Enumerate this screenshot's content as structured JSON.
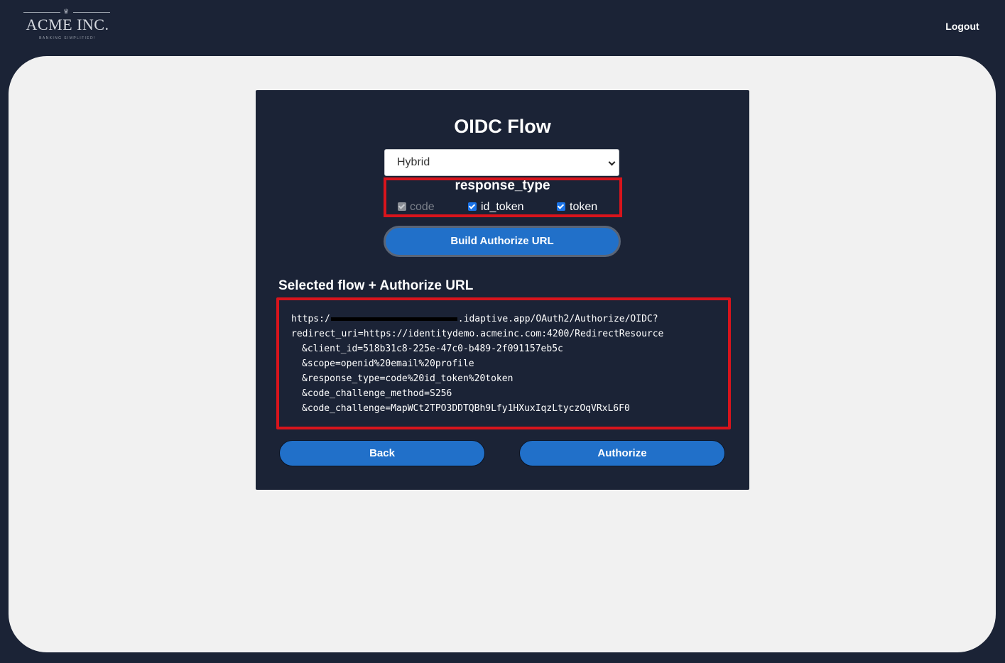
{
  "header": {
    "logo_name": "ACME INC.",
    "logo_tagline": "BANKING SIMPLIFIED!",
    "logout_label": "Logout"
  },
  "card": {
    "title": "OIDC Flow",
    "flow_select": {
      "selected": "Hybrid"
    },
    "response_type": {
      "label": "response_type",
      "options": [
        {
          "label": "code",
          "checked": true,
          "disabled": true
        },
        {
          "label": "id_token",
          "checked": true,
          "disabled": false
        },
        {
          "label": "token",
          "checked": true,
          "disabled": false
        }
      ]
    },
    "build_button_label": "Build Authorize URL",
    "url_section": {
      "heading": "Selected flow + Authorize URL",
      "url_line1_prefix": "https:/",
      "url_line1_suffix": ".idaptive.app/OAuth2/Authorize/OIDC?",
      "url_lines": [
        "redirect_uri=https://identitydemo.acmeinc.com:4200/RedirectResource",
        "&client_id=518b31c8-225e-47c0-b489-2f091157eb5c",
        "&scope=openid%20email%20profile",
        "&response_type=code%20id_token%20token",
        "&code_challenge_method=S256",
        "&code_challenge=MapWCt2TPO3DDTQBh9Lfy1HXuxIqzLtyczOqVRxL6F0"
      ]
    },
    "back_label": "Back",
    "authorize_label": "Authorize"
  }
}
